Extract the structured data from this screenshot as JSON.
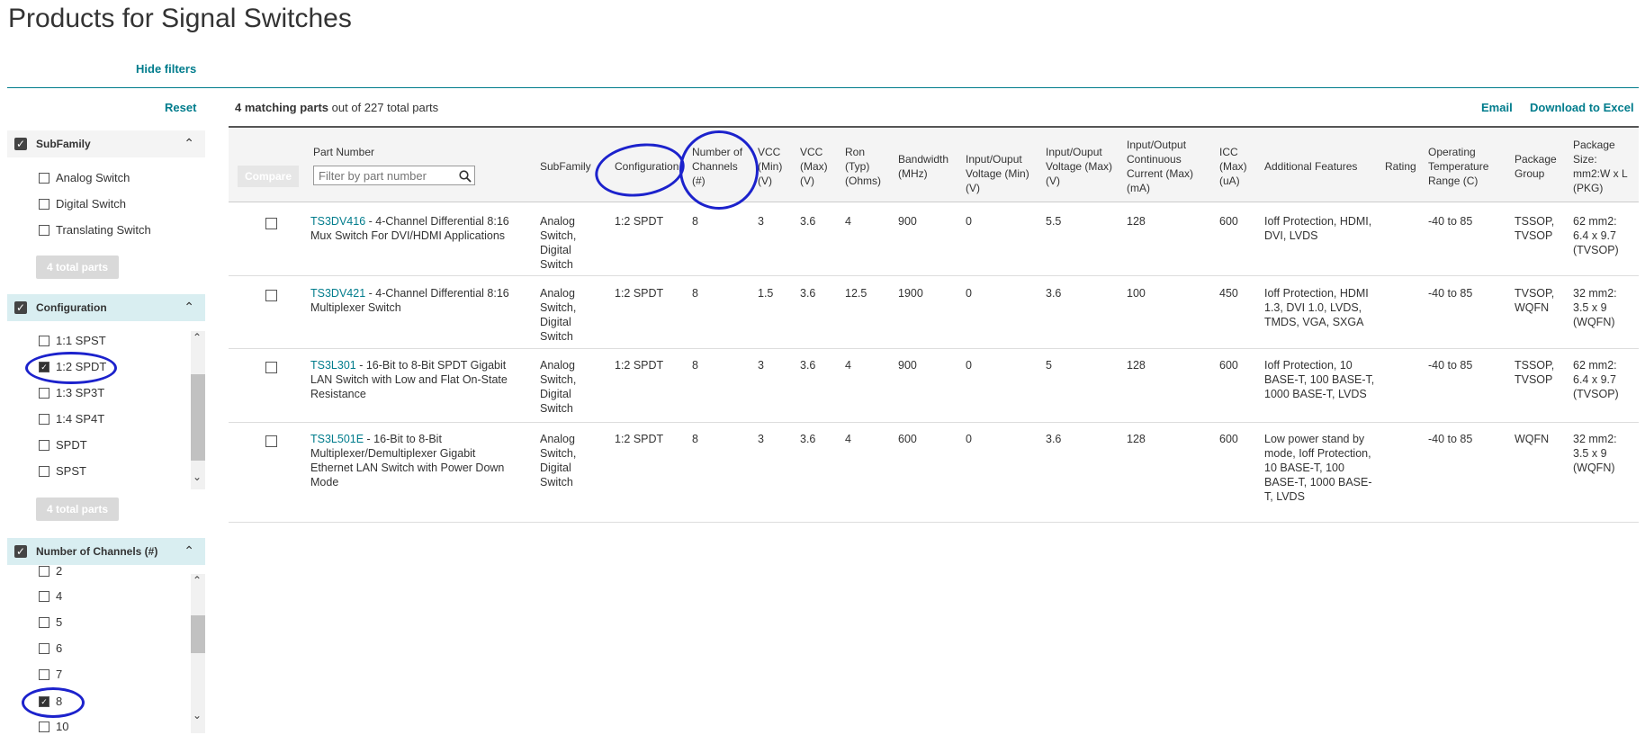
{
  "page": {
    "title": "Products for Signal Switches",
    "hide_filters": "Hide filters",
    "reset": "Reset",
    "matching_count": "4 matching parts",
    "matching_rest": " out of 227 total parts",
    "email": "Email",
    "download": "Download to Excel"
  },
  "filters": {
    "subfamily": {
      "title": "SubFamily",
      "options": [
        {
          "label": "Analog Switch",
          "checked": false
        },
        {
          "label": "Digital Switch",
          "checked": false
        },
        {
          "label": "Translating Switch",
          "checked": false
        }
      ],
      "total": "4 total parts"
    },
    "configuration": {
      "title": "Configuration",
      "options": [
        {
          "label": "1:1 SPST",
          "checked": false
        },
        {
          "label": "1:2 SPDT",
          "checked": true
        },
        {
          "label": "1:3 SP3T",
          "checked": false
        },
        {
          "label": "1:4 SP4T",
          "checked": false
        },
        {
          "label": "SPDT",
          "checked": false
        },
        {
          "label": "SPST",
          "checked": false
        }
      ],
      "total": "4 total parts"
    },
    "channels": {
      "title": "Number of Channels (#)",
      "options": [
        {
          "label": "2",
          "checked": false
        },
        {
          "label": "4",
          "checked": false
        },
        {
          "label": "5",
          "checked": false
        },
        {
          "label": "6",
          "checked": false
        },
        {
          "label": "7",
          "checked": false
        },
        {
          "label": "8",
          "checked": true
        },
        {
          "label": "10",
          "checked": false
        }
      ]
    }
  },
  "table": {
    "compare": "Compare",
    "filter_placeholder": "Filter by part number",
    "headers": {
      "part": "Part Number",
      "subfamily": "SubFamily",
      "config": "Configuration",
      "channels": "Number of Channels (#)",
      "vccmin": "VCC (Min) (V)",
      "vccmax": "VCC (Max) (V)",
      "ron": "Ron (Typ) (Ohms)",
      "bw": "Bandwidth (MHz)",
      "iovmin": "Input/Ouput Voltage (Min) (V)",
      "iovmax": "Input/Ouput Voltage (Max) (V)",
      "iocur": "Input/Output Continuous Current (Max) (mA)",
      "icc": "ICC (Max) (uA)",
      "features": "Additional Features",
      "rating": "Rating",
      "temp": "Operating Temperature Range (C)",
      "pkg": "Package Group",
      "size": "Package Size: mm2:W x L (PKG)"
    },
    "rows": [
      {
        "part": "TS3DV416",
        "desc": " - 4-Channel Differential 8:16 Mux Switch For DVI/HDMI Applications",
        "subfamily": "Analog Switch, Digital Switch",
        "config": "1:2 SPDT",
        "channels": "8",
        "vccmin": "3",
        "vccmax": "3.6",
        "ron": "4",
        "bw": "900",
        "iovmin": "0",
        "iovmax": "5.5",
        "iocur": "128",
        "icc": "600",
        "features": "Ioff Protection, HDMI, DVI, LVDS",
        "rating": "",
        "temp": "-40 to 85",
        "pkg": "TSSOP, TVSOP",
        "size": "62 mm2: 6.4 x 9.7 (TVSOP)"
      },
      {
        "part": "TS3DV421",
        "desc": " - 4-Channel Differential 8:16 Multiplexer Switch",
        "subfamily": "Analog Switch, Digital Switch",
        "config": "1:2 SPDT",
        "channels": "8",
        "vccmin": "1.5",
        "vccmax": "3.6",
        "ron": "12.5",
        "bw": "1900",
        "iovmin": "0",
        "iovmax": "3.6",
        "iocur": "100",
        "icc": "450",
        "features": "Ioff Protection, HDMI 1.3, DVI 1.0, LVDS, TMDS, VGA, SXGA",
        "rating": "",
        "temp": "-40 to 85",
        "pkg": "TVSOP, WQFN",
        "size": "32 mm2: 3.5 x 9 (WQFN)"
      },
      {
        "part": "TS3L301",
        "desc": " - 16-Bit to 8-Bit SPDT Gigabit LAN Switch with Low and Flat On-State Resistance",
        "subfamily": "Analog Switch, Digital Switch",
        "config": "1:2 SPDT",
        "channels": "8",
        "vccmin": "3",
        "vccmax": "3.6",
        "ron": "4",
        "bw": "900",
        "iovmin": "0",
        "iovmax": "5",
        "iocur": "128",
        "icc": "600",
        "features": "Ioff Protection, 10 BASE-T, 100 BASE-T, 1000 BASE-T, LVDS",
        "rating": "",
        "temp": "-40 to 85",
        "pkg": "TSSOP, TVSOP",
        "size": "62 mm2: 6.4 x 9.7 (TVSOP)"
      },
      {
        "part": "TS3L501E",
        "desc": " - 16-Bit to 8-Bit Multiplexer/Demultiplexer Gigabit Ethernet LAN Switch with Power Down Mode",
        "subfamily": "Analog Switch, Digital Switch",
        "config": "1:2 SPDT",
        "channels": "8",
        "vccmin": "3",
        "vccmax": "3.6",
        "ron": "4",
        "bw": "600",
        "iovmin": "0",
        "iovmax": "3.6",
        "iocur": "128",
        "icc": "600",
        "features": "Low power stand by mode, Ioff Protection, 10 BASE-T, 100 BASE-T, 1000 BASE-T, LVDS",
        "rating": "",
        "temp": "-40 to 85",
        "pkg": "WQFN",
        "size": "32 mm2: 3.5 x 9 (WQFN)"
      }
    ]
  }
}
